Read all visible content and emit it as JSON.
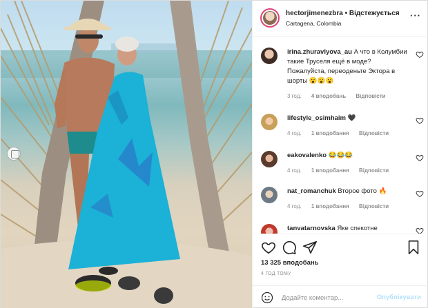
{
  "post": {
    "username": "hectorjimenezbra",
    "follow_status": "• Відстежується",
    "location": "Cartagena, Colombia",
    "more_icon": "more-horizontal-icon"
  },
  "comments": [
    {
      "username": "irina.zhuravlyova_au",
      "text": "А что в Колумбии такие Труселя ещё в моде? Пожалуйста, переоденьте Эктора в шорты 😮😮😮",
      "time": "3 год.",
      "likes": "4 вподобань",
      "reply": "Відповісти"
    },
    {
      "username": "lifestyle_osimhaim",
      "text": "🖤",
      "time": "4 год.",
      "likes": "1 вподобання",
      "reply": "Відповісти"
    },
    {
      "username": "eakovalenko",
      "text": "😂😂😂",
      "time": "4 год.",
      "likes": "1 вподобання",
      "reply": "Відповісти"
    },
    {
      "username": "nat_romanchuk",
      "text": "Второе фото 🔥",
      "time": "4 год.",
      "likes": "1 вподобання",
      "reply": "Відповісти"
    },
    {
      "username": "tanvatarnovska",
      "text": "Яке спекотне"
    }
  ],
  "actions": {
    "like_icon": "heart-icon",
    "comment_icon": "comment-icon",
    "share_icon": "send-icon",
    "save_icon": "bookmark-icon",
    "likes_count": "13 325 вподобань",
    "time_ago": "4 ГОД ТОМУ"
  },
  "add_comment": {
    "placeholder": "Додайте коментар...",
    "publish_label": "Опублікувати",
    "emoji_icon": "smiley-icon"
  },
  "colors": {
    "story_ring": "#e0457b",
    "publish_disabled": "#b2dffc",
    "secondary_text": "#8e8e8e"
  }
}
